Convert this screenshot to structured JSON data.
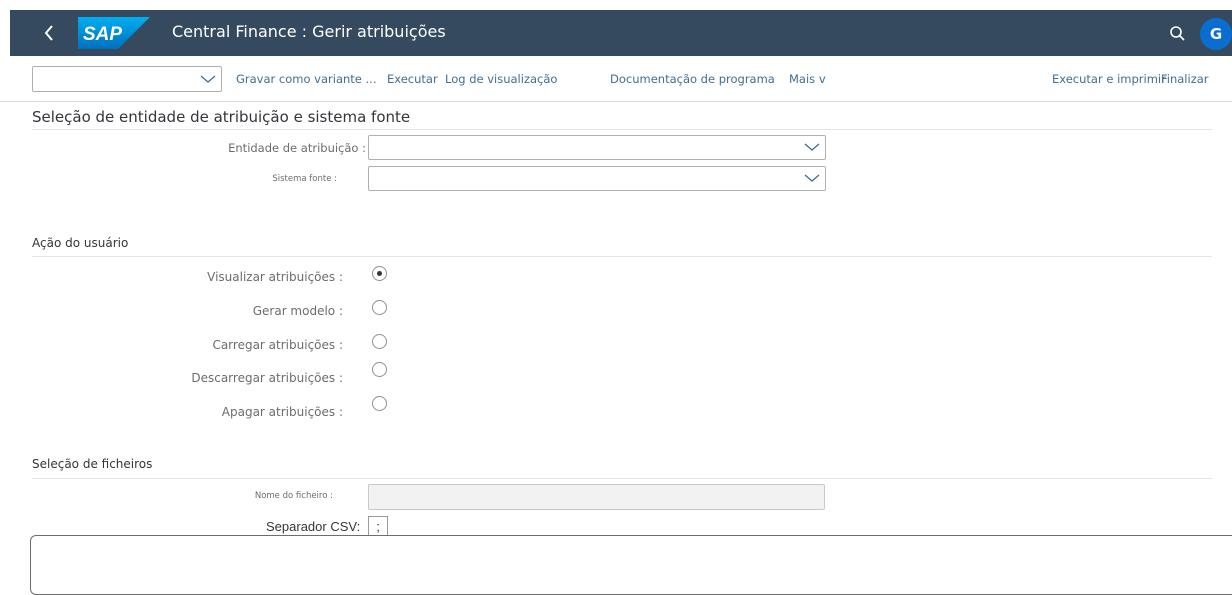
{
  "shell": {
    "logo_text": "SAP",
    "title": "Central Finance : Gerir atribuições",
    "avatar_initial": "G",
    "colors": {
      "shell_bg": "#354a5f",
      "avatar_bg": "#0a6ed1",
      "link": "#3f6f95"
    },
    "icons": [
      "back-icon",
      "search-icon"
    ]
  },
  "toolbar": {
    "variant_value": "",
    "links": {
      "save_variant": "Gravar como variante ...",
      "execute": "Executar",
      "view_log": "Log de visualização",
      "program_doc": "Documentação de programa",
      "more": "Mais",
      "more_chevron": "v",
      "execute_print": "Executar e imprimir",
      "finish": "Finalizar"
    }
  },
  "section1": {
    "title": "Seleção de entidade de atribuição e sistema fonte",
    "fields": {
      "entity_label": "Entidade de atribuição :",
      "entity_value": "",
      "source_label": "Sistema fonte :",
      "source_value": ""
    }
  },
  "user_action": {
    "title": "Ação do usuário",
    "options": [
      {
        "label": "Visualizar atribuições :",
        "checked": true
      },
      {
        "label": "Gerar modelo :",
        "checked": false
      },
      {
        "label": "Carregar atribuições :",
        "checked": false
      },
      {
        "label": "Descarregar atribuições :",
        "checked": false
      },
      {
        "label": "Apagar atribuições :",
        "checked": false
      }
    ]
  },
  "file_selection": {
    "title": "Seleção de ficheiros",
    "filename_label": "Nome do ficheiro :",
    "filename_value": "",
    "csv_label": "Separador CSV:",
    "csv_value": ";"
  }
}
